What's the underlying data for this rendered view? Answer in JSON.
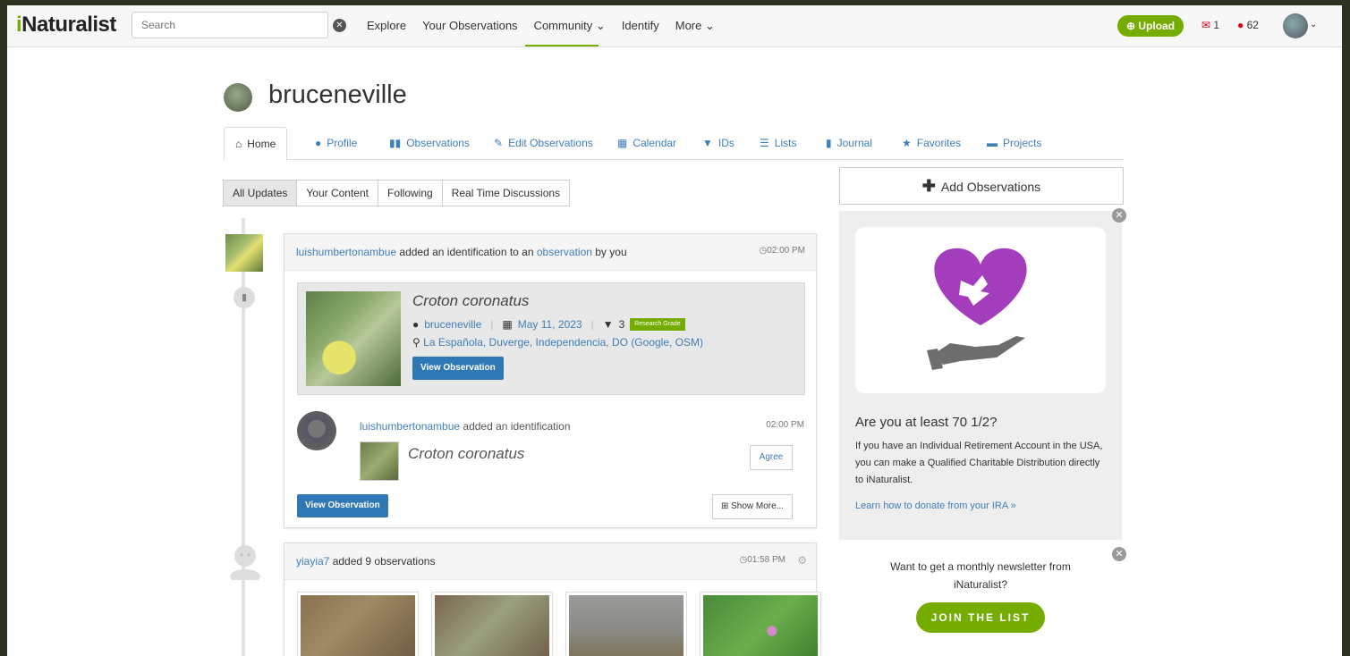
{
  "nav": {
    "logo": "iNaturalist",
    "search_placeholder": "Search",
    "links": [
      "Explore",
      "Your Observations",
      "Community ⌄",
      "Identify",
      "More ⌄"
    ],
    "upload_label": "Upload",
    "messages_count": "1",
    "notifications_count": "62"
  },
  "profile": {
    "username": "bruceneville"
  },
  "tabs": [
    "Home",
    "Profile",
    "Observations",
    "Edit Observations",
    "Calendar",
    "IDs",
    "Lists",
    "Journal",
    "Favorites",
    "Projects"
  ],
  "filters": [
    "All Updates",
    "Your Content",
    "Following",
    "Real Time Discussions"
  ],
  "feed": {
    "item1": {
      "user": "luishumbertonambue",
      "action_mid": " added an identification to an ",
      "link": "observation",
      "action_end": " by you",
      "time": "02:00 PM",
      "obs": {
        "name": "Croton coronatus",
        "observer": "bruceneville",
        "date": "May 11, 2023",
        "id_count": "3",
        "grade": "Research Grade",
        "location": "La Española, Duverge, Independencia, DO",
        "loc_links": "(Google, OSM)",
        "button": "View Observation"
      },
      "identification": {
        "user": "luishumbertonambue",
        "text": " added an identification",
        "time": "02:00 PM",
        "taxon": "Croton coronatus",
        "agree": "Agree"
      },
      "view_button": "View Observation",
      "show_more": "Show More..."
    },
    "item2": {
      "user": "yiayia7",
      "text": " added 9 observations",
      "time": "01:58 PM"
    }
  },
  "sidebar": {
    "add_observations": "Add Observations",
    "promo": {
      "title": "Are you at least 70 1/2?",
      "body": "If you have an Individual Retirement Account in the USA, you can make a Qualified Charitable Distribution directly to iNaturalist.",
      "link": "Learn how to donate from your IRA »"
    },
    "newsletter": {
      "text": "Want to get a monthly newsletter from iNaturalist?",
      "button": "JOIN THE LIST"
    }
  },
  "colors": {
    "brand_green": "#74ac00",
    "link_blue": "#3e7fb8",
    "button_blue": "#2f77b5",
    "alert_red": "#d9001b",
    "heart_purple": "#a43dbb"
  }
}
